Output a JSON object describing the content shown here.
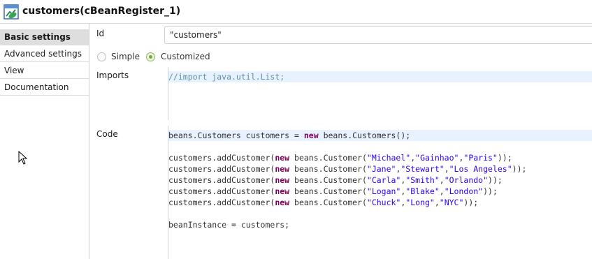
{
  "title": {
    "text": "customers(cBeanRegister_1)",
    "icon": "bean-register-icon"
  },
  "nav": {
    "items": [
      {
        "label": "Basic settings",
        "active": true
      },
      {
        "label": "Advanced settings",
        "active": false
      },
      {
        "label": "View",
        "active": false
      },
      {
        "label": "Documentation",
        "active": false
      }
    ]
  },
  "form": {
    "id_label": "Id",
    "id_value": "\"customers\"",
    "mode": {
      "simple_label": "Simple",
      "customized_label": "Customized",
      "selected": "Customized"
    },
    "imports_label": "Imports",
    "imports_code": "//import java.util.List;",
    "code_label": "Code",
    "code": {
      "line1": {
        "a": "beans.Customers customers = ",
        "kw": "new",
        "b": " beans.Customers();"
      },
      "customers": [
        {
          "prefix": "customers.addCustomer(",
          "kw": "new",
          "cls": " beans.Customer(",
          "first": "\"Michael\"",
          "last": "\"Gainhao\"",
          "city": "\"Paris\"",
          "suffix": "));"
        },
        {
          "prefix": "customers.addCustomer(",
          "kw": "new",
          "cls": " beans.Customer(",
          "first": "\"Jane\"",
          "last": "\"Stewart\"",
          "city": "\"Los Angeles\"",
          "suffix": "));"
        },
        {
          "prefix": "customers.addCustomer(",
          "kw": "new",
          "cls": " beans.Customer(",
          "first": "\"Carla\"",
          "last": "\"Smith\"",
          "city": "\"Orlando\"",
          "suffix": "));"
        },
        {
          "prefix": "customers.addCustomer(",
          "kw": "new",
          "cls": " beans.Customer(",
          "first": "\"Logan\"",
          "last": "\"Blake\"",
          "city": "\"London\"",
          "suffix": "));"
        },
        {
          "prefix": "customers.addCustomer(",
          "kw": "new",
          "cls": " beans.Customer(",
          "first": "\"Chuck\"",
          "last": "\"Long\"",
          "city": "\"NYC\"",
          "suffix": "));"
        }
      ],
      "last_line": "beanInstance = customers;"
    }
  },
  "colors": {
    "keyword": "#7f0055",
    "string": "#2a00ff",
    "comment": "#5f8fa3",
    "current_line": "#e8f2fe",
    "radio_selected": "#79a843"
  }
}
